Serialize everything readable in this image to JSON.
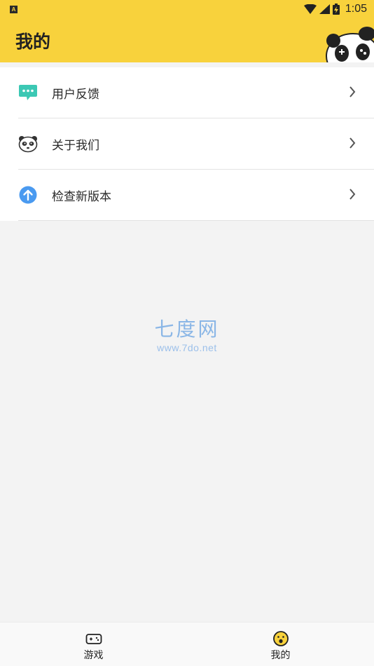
{
  "status_bar": {
    "notification_letter": "A",
    "time": "1:05",
    "icons": [
      "wifi-icon",
      "signal-icon",
      "battery-charging-icon"
    ]
  },
  "header": {
    "title": "我的",
    "decoration": "panda-gamepad-icon"
  },
  "menu": {
    "items": [
      {
        "label": "用户反馈",
        "icon": "chat-bubble-icon",
        "icon_color": "#3cc8b4"
      },
      {
        "label": "关于我们",
        "icon": "panda-face-icon",
        "icon_color": "#333333"
      },
      {
        "label": "检查新版本",
        "icon": "arrow-up-circle-icon",
        "icon_color": "#4a9af0"
      }
    ]
  },
  "watermark": {
    "title": "七度网",
    "url": "www.7do.net"
  },
  "tabbar": {
    "tabs": [
      {
        "label": "游戏",
        "icon": "gamepad-icon"
      },
      {
        "label": "我的",
        "icon": "smiley-face-icon",
        "active": true
      }
    ]
  },
  "colors": {
    "brand_yellow": "#f8d23c",
    "background": "#f3f3f3",
    "feedback_teal": "#3cc8b4",
    "update_blue": "#4a9af0",
    "watermark_blue": "#8ab6e6"
  }
}
